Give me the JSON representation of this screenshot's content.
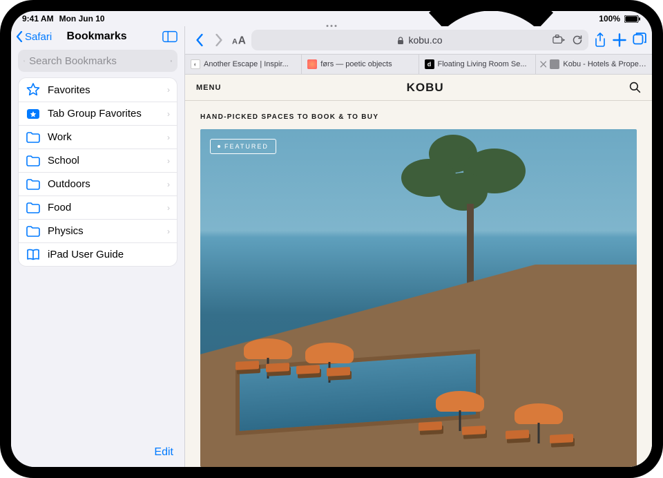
{
  "status": {
    "time": "9:41 AM",
    "date": "Mon Jun 10",
    "battery": "100%"
  },
  "sidebar": {
    "back_label": "Safari",
    "title": "Bookmarks",
    "search_placeholder": "Search Bookmarks",
    "items": [
      {
        "label": "Favorites",
        "icon": "star"
      },
      {
        "label": "Tab Group Favorites",
        "icon": "tabstar"
      },
      {
        "label": "Work",
        "icon": "folder"
      },
      {
        "label": "School",
        "icon": "folder"
      },
      {
        "label": "Outdoors",
        "icon": "folder"
      },
      {
        "label": "Food",
        "icon": "folder"
      },
      {
        "label": "Physics",
        "icon": "folder"
      },
      {
        "label": "iPad User Guide",
        "icon": "book"
      }
    ],
    "edit_label": "Edit"
  },
  "toolbar": {
    "address": "kobu.co"
  },
  "tabs": [
    {
      "label": "Another Escape | Inspir..."
    },
    {
      "label": "førs — poetic objects"
    },
    {
      "label": "Floating Living Room Se..."
    },
    {
      "label": "Kobu - Hotels & Propert..."
    }
  ],
  "page": {
    "menu_label": "MENU",
    "logo": "KOBU",
    "tagline": "HAND-PICKED SPACES TO BOOK & TO BUY",
    "featured_label": "FEATURED"
  }
}
